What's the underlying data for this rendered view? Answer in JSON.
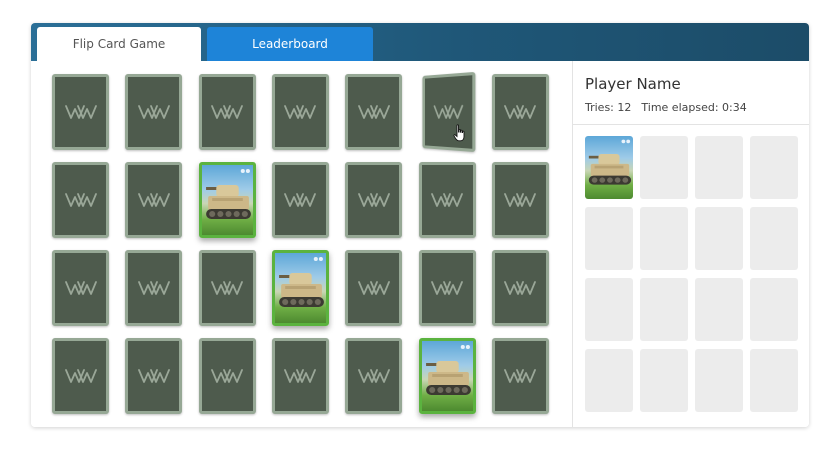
{
  "tabs": {
    "game_label": "Flip Card Game",
    "leaderboard_label": "Leaderboard"
  },
  "player": {
    "name": "Player Name",
    "tries": "Tries: 12",
    "time_elapsed": "Time elapsed: 0:34"
  },
  "board": {
    "rows": 4,
    "cols": 7,
    "card_back_icon": "ww-logo-icon",
    "card_face_icon": "tank-icon",
    "face_up": [
      [
        1,
        2
      ],
      [
        2,
        3
      ],
      [
        3,
        5
      ]
    ],
    "hovered": [
      0,
      5
    ]
  },
  "matched_slots": {
    "rows": 4,
    "cols": 4,
    "filled": [
      [
        0,
        0
      ]
    ]
  },
  "colors": {
    "tabbar": "#1f5778",
    "active_tab": "#1e84d8",
    "card_back": "#4e5b4d",
    "card_border": "#96a895",
    "face_border": "#5bb33f",
    "slot": "#ececec"
  }
}
